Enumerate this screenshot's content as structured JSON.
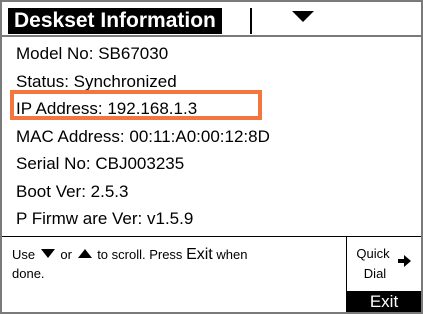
{
  "header": {
    "title": "Deskset Information",
    "menu_icon": "triangle-down-icon"
  },
  "info": {
    "items": [
      "Model No: SB67030",
      "Status: Synchronized",
      "IP Address: 192.168.1.3",
      "MAC Address: 00:11:A0:00:12:8D",
      "Serial No: CBJ003235",
      "Boot Ver: 2.5.3",
      "P Firmw are Ver: v1.5.9"
    ],
    "highlight_color": "#f4763f"
  },
  "footer": {
    "hint": {
      "use": "Use",
      "or": "or",
      "press": "to scroll. Press",
      "exit_word": "Exit",
      "when": "when",
      "done": "done."
    },
    "quick_dial": {
      "line1": "Quick",
      "line2": "Dial",
      "icon": "arrow-right-icon"
    },
    "exit_label": "Exit"
  }
}
